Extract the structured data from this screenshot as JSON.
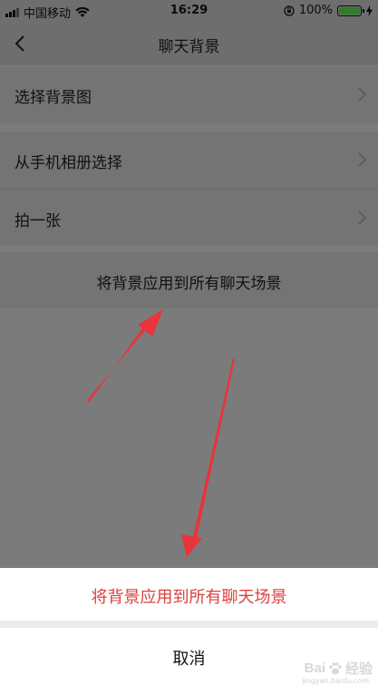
{
  "status_bar": {
    "carrier": "中国移动",
    "time": "16:29",
    "battery_percent": "100%",
    "battery_level": 1.0
  },
  "nav": {
    "title": "聊天背景",
    "back_icon": "chevron-left-icon"
  },
  "groups": {
    "select_background": "选择背景图",
    "from_album": "从手机相册选择",
    "take_photo": "拍一张",
    "apply_all": "将背景应用到所有聊天场景"
  },
  "action_sheet": {
    "apply_all": "将背景应用到所有聊天场景",
    "cancel": "取消"
  },
  "watermark": {
    "brand": "Bai",
    "brand_cn": "经验",
    "url": "jingyan.baidu.com"
  },
  "colors": {
    "destructive": "#dc3f3f",
    "annotation_arrow": "#e8343a",
    "battery": "#2f7d2a"
  }
}
